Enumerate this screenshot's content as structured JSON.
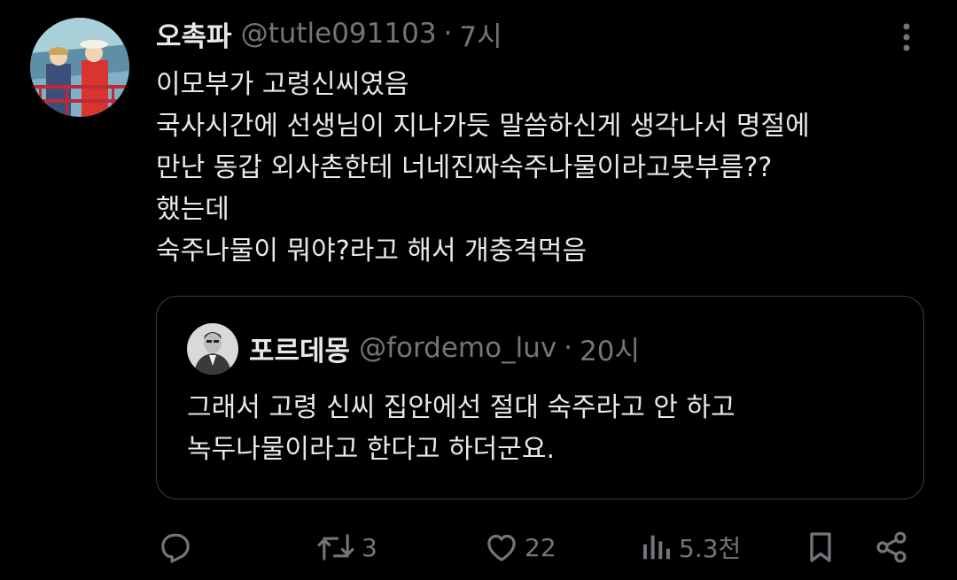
{
  "tweet": {
    "display_name": "오촉파",
    "handle": "@tutle091103",
    "separator": "·",
    "time": "7시",
    "lines": [
      "이모부가 고령신씨였음",
      "국사시간에 선생님이 지나가듯 말씀하신게 생각나서 명절에",
      "만난 동갑 외사촌한테 너네진짜숙주나물이라고못부름??",
      "했는데",
      "숙주나물이 뭐야?라고 해서 개충격먹음"
    ]
  },
  "quote": {
    "display_name": "포르데몽",
    "handle": "@fordemo_luv",
    "separator": "·",
    "time": "20시",
    "lines": [
      "그래서 고령 신씨 집안에선 절대 숙주라고 안 하고",
      "녹두나물이라고 한다고 하더군요."
    ]
  },
  "actions": {
    "reply": {
      "icon": "reply-icon",
      "count": ""
    },
    "retweet": {
      "icon": "retweet-icon",
      "count": "3"
    },
    "like": {
      "icon": "heart-icon",
      "count": "22"
    },
    "views": {
      "icon": "views-icon",
      "count": "5.3천"
    },
    "bookmark": {
      "icon": "bookmark-icon",
      "count": ""
    },
    "share": {
      "icon": "share-icon",
      "count": ""
    }
  },
  "colors": {
    "background": "#000000",
    "text_primary": "#e7e9ea",
    "text_secondary": "#71767b",
    "border": "#3a3d41"
  }
}
